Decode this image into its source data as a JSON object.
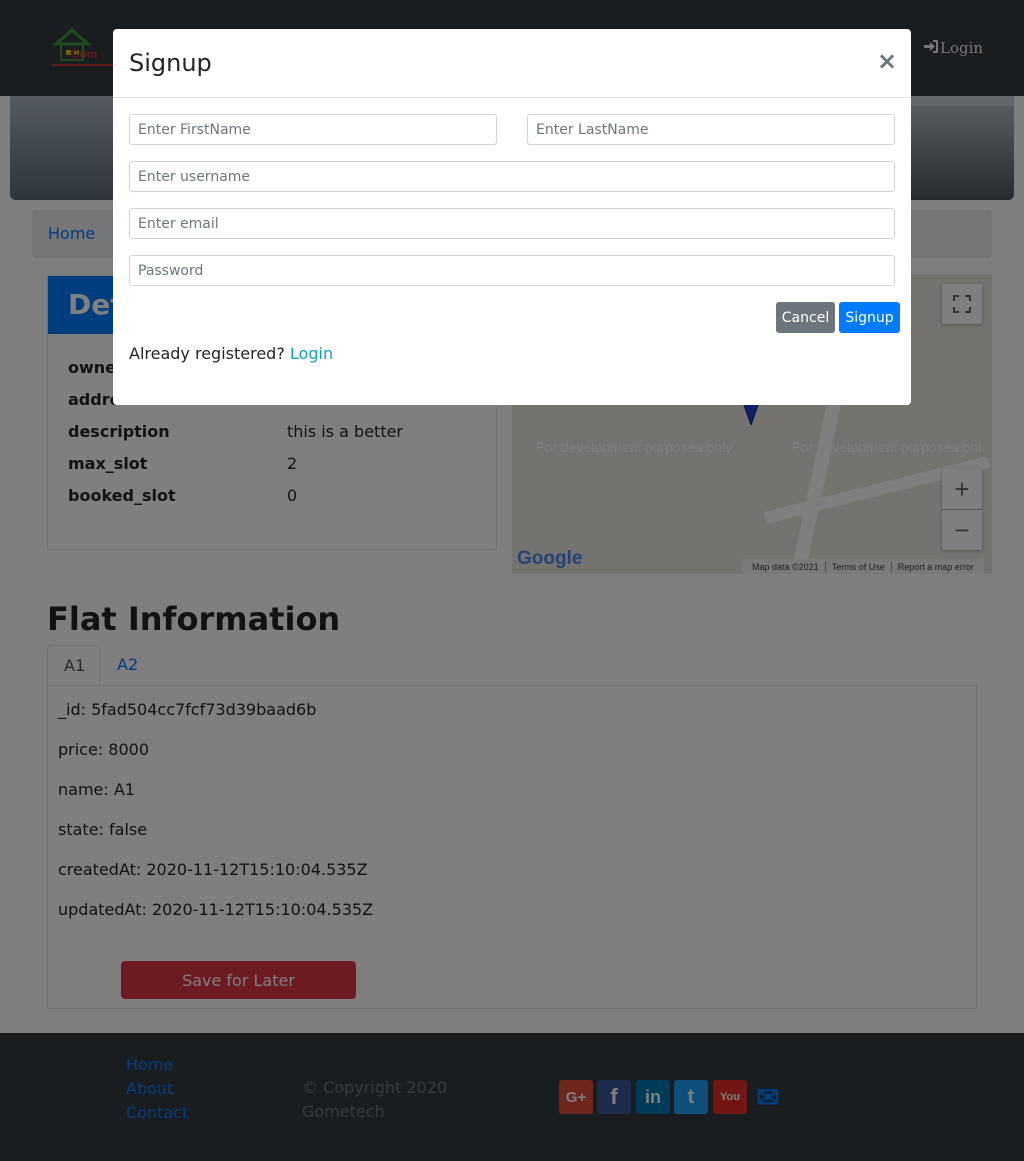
{
  "navbar": {
    "login_label": "Login",
    "login_icon": "sign-in-icon"
  },
  "breadcrumb": {
    "home": "Home",
    "separator": "/"
  },
  "details": {
    "header": "Det",
    "rows": [
      {
        "key": "owner",
        "value": ""
      },
      {
        "key": "addre",
        "value": ""
      },
      {
        "key": "description",
        "value": "this is a better"
      },
      {
        "key": "max_slot",
        "value": "2"
      },
      {
        "key": "booked_slot",
        "value": "0"
      }
    ]
  },
  "map": {
    "dev_text_1": "For development purposes only",
    "dev_text_2": "For development purposes onl",
    "zoom_in": "+",
    "zoom_out": "−",
    "logo": "Google",
    "attribution": [
      "Map data ©2021",
      "Terms of Use",
      "Report a map error"
    ]
  },
  "flat": {
    "title": "Flat Information",
    "tabs": [
      "A1",
      "A2"
    ],
    "fields": [
      "_id: 5fad504cc7fcf73d39baad6b",
      "price: 8000",
      "name: A1",
      "state: false",
      "createdAt: 2020-11-12T15:10:04.535Z",
      "updatedAt: 2020-11-12T15:10:04.535Z"
    ],
    "save_label": "Save for Later"
  },
  "footer": {
    "links": [
      "Home",
      "About",
      "Contact"
    ],
    "copyright": "© Copyright 2020 Gometech",
    "social": [
      {
        "name": "google-plus",
        "glyph": "G+",
        "color": "#dd4b39"
      },
      {
        "name": "facebook",
        "glyph": "f",
        "color": "#3b5998"
      },
      {
        "name": "linkedin",
        "glyph": "in",
        "color": "#0077b5"
      },
      {
        "name": "twitter",
        "glyph": "t",
        "color": "#1da1f2"
      },
      {
        "name": "youtube",
        "glyph": "You",
        "color": "#e52d27"
      },
      {
        "name": "email",
        "glyph": "✉",
        "color": "#007bff"
      }
    ]
  },
  "modal": {
    "title": "Signup",
    "close": "×",
    "firstname_placeholder": "Enter FirstName",
    "lastname_placeholder": "Enter LastName",
    "username_placeholder": "Enter username",
    "email_placeholder": "Enter email",
    "password_placeholder": "Password",
    "cancel_label": "Cancel",
    "signup_label": "Signup",
    "already_text": "Already registered?",
    "login_link": "Login"
  }
}
